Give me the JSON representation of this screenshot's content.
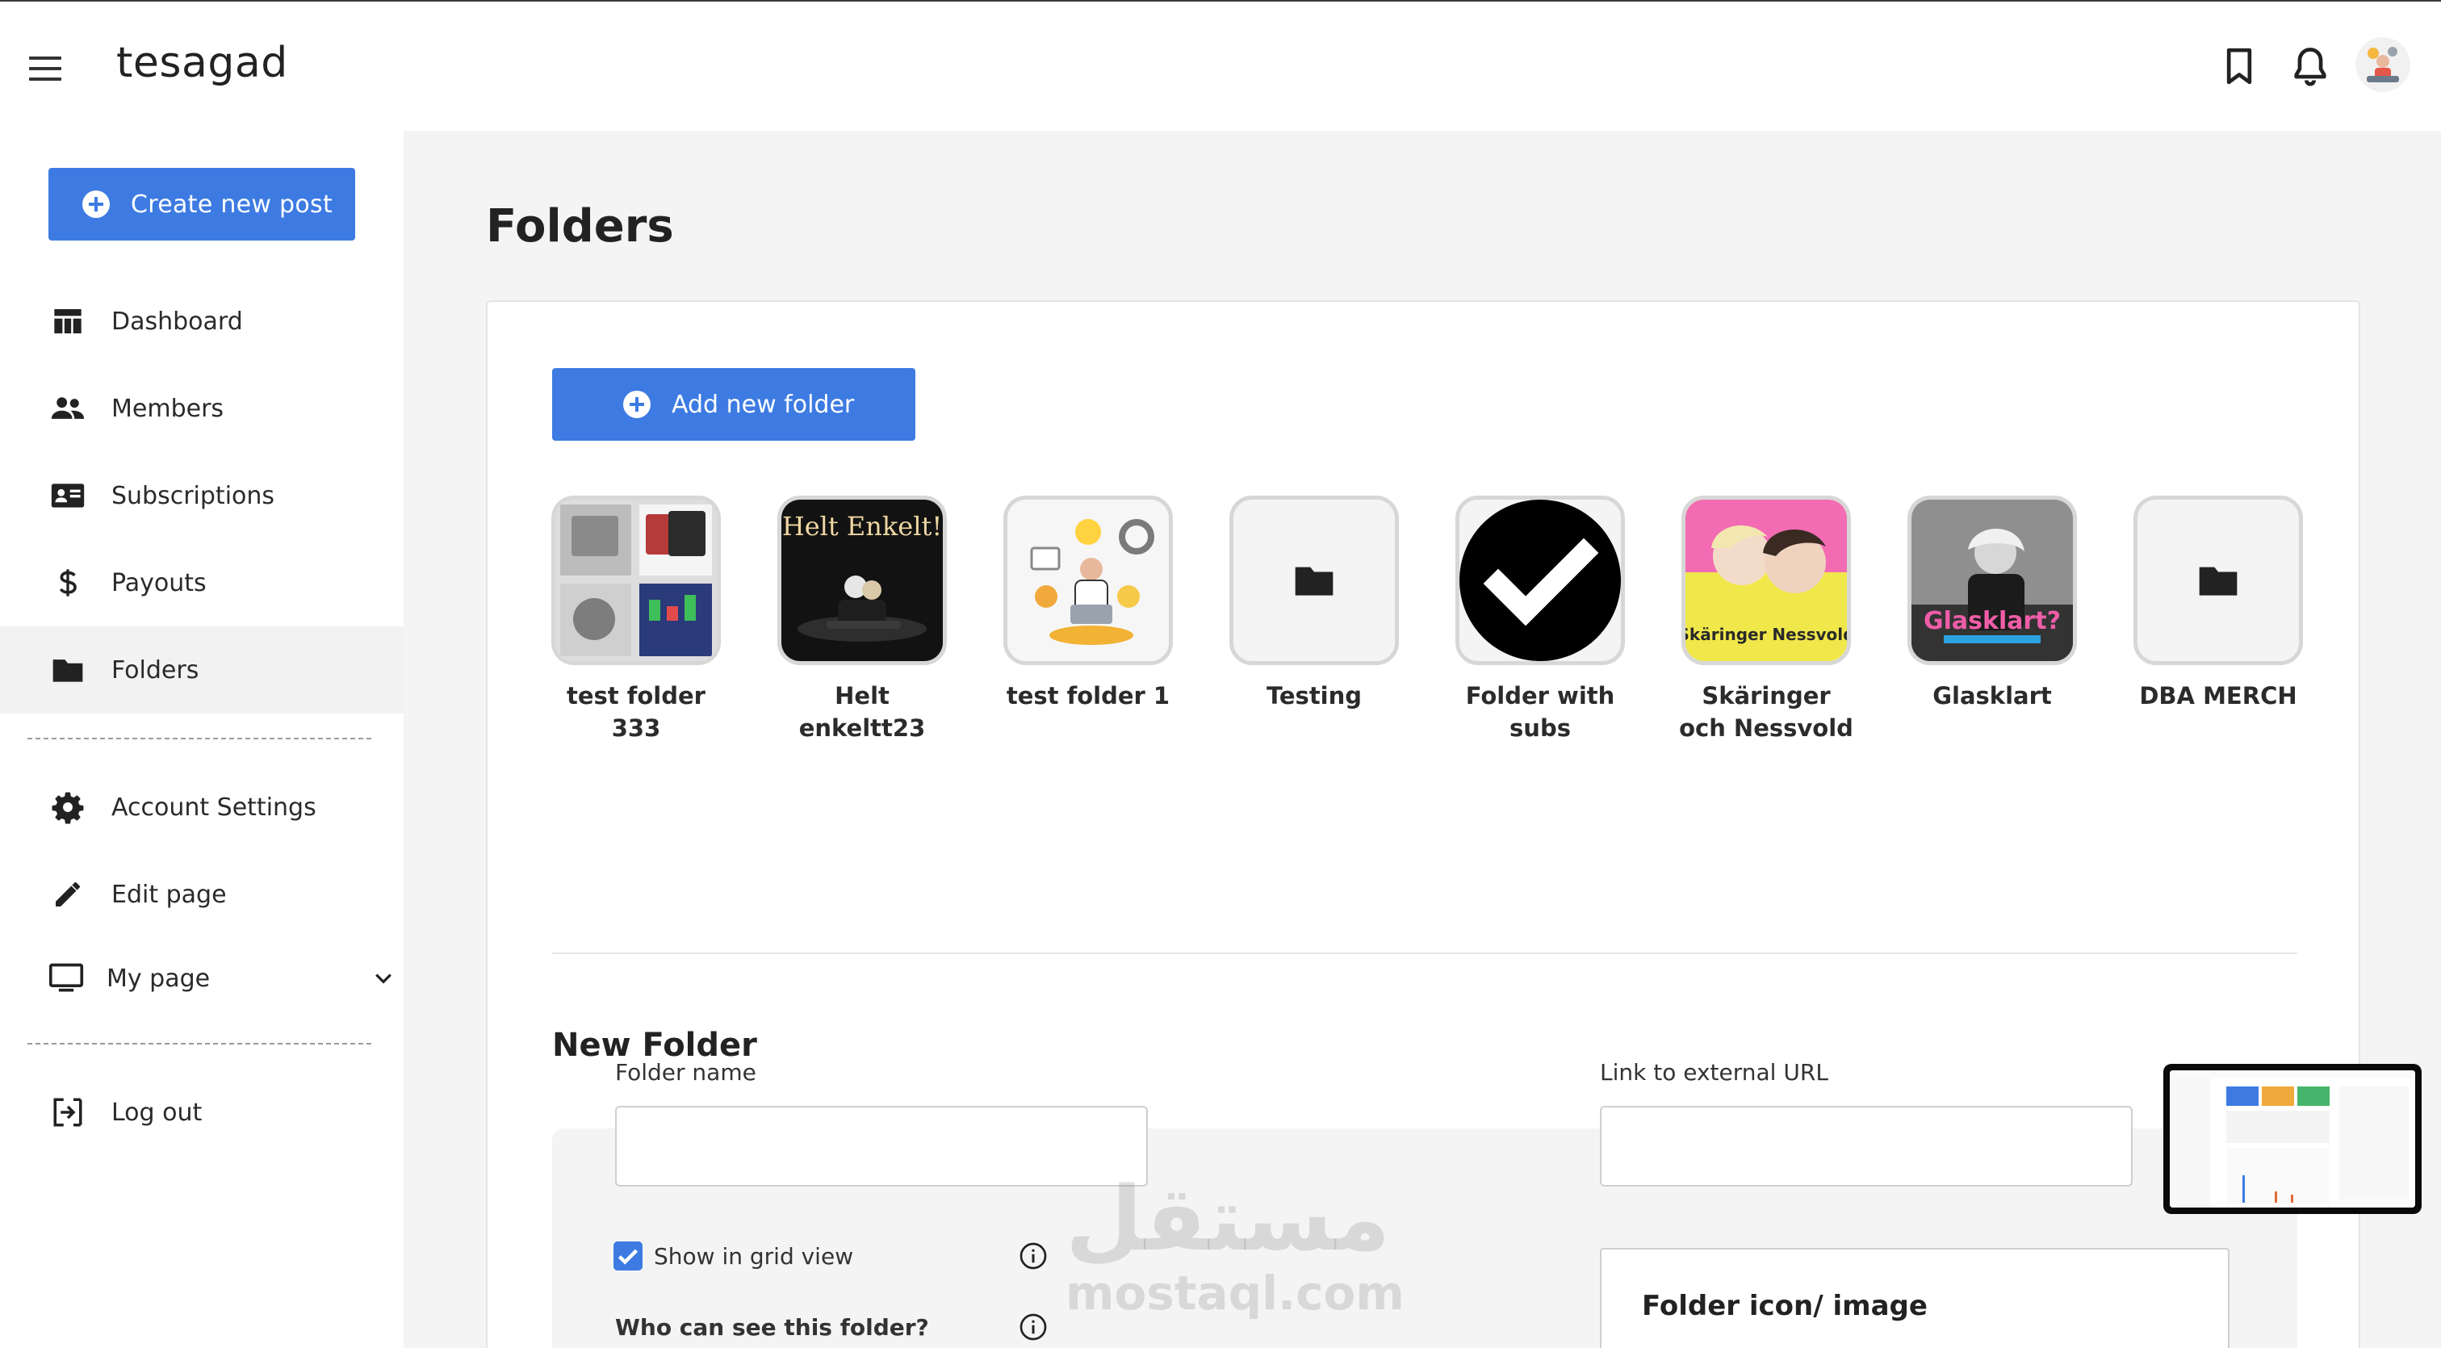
{
  "app": {
    "brand": "tesagad"
  },
  "header": {
    "icons": [
      "menu-icon",
      "bookmark-icon",
      "bell-icon",
      "avatar"
    ]
  },
  "sidebar": {
    "create_label": "Create new post",
    "items": [
      {
        "label": "Dashboard",
        "icon": "dashboard-icon"
      },
      {
        "label": "Members",
        "icon": "members-icon"
      },
      {
        "label": "Subscriptions",
        "icon": "subscriptions-icon"
      },
      {
        "label": "Payouts",
        "icon": "dollar-icon"
      },
      {
        "label": "Folders",
        "icon": "folder-icon",
        "active": true
      },
      {
        "label": "Account Settings",
        "icon": "gear-icon"
      },
      {
        "label": "Edit page",
        "icon": "pencil-icon"
      },
      {
        "label": "My page",
        "icon": "monitor-icon"
      },
      {
        "label": "Log out",
        "icon": "logout-icon"
      }
    ]
  },
  "main": {
    "title": "Folders",
    "add_folder_label": "Add new folder",
    "folders": [
      {
        "name": "test folder 333"
      },
      {
        "name": "Helt enkeltt23",
        "image_text": "Helt Enkelt!"
      },
      {
        "name": "test folder 1"
      },
      {
        "name": "Testing"
      },
      {
        "name": "Folder with subs"
      },
      {
        "name": "Skäringer och Nessvold",
        "image_text": "Skäringer Nessvold"
      },
      {
        "name": "Glasklart",
        "image_text": "Glasklart?"
      },
      {
        "name": "DBA MERCH"
      }
    ],
    "new_folder": {
      "title": "New Folder",
      "folder_name_label": "Folder name",
      "folder_name_value": "",
      "external_url_label": "Link to external URL",
      "external_url_value": "",
      "show_grid_label": "Show in grid view",
      "show_grid_checked": true,
      "visibility_label": "Who can see this folder?",
      "icon_image_label": "Folder icon/ image"
    }
  },
  "watermark": {
    "arabic": "مستقل",
    "latin": "mostaql.com"
  },
  "colors": {
    "accent": "#3d7be2",
    "sidebar_active": "#f2f2f2",
    "main_bg": "#f4f4f4"
  }
}
